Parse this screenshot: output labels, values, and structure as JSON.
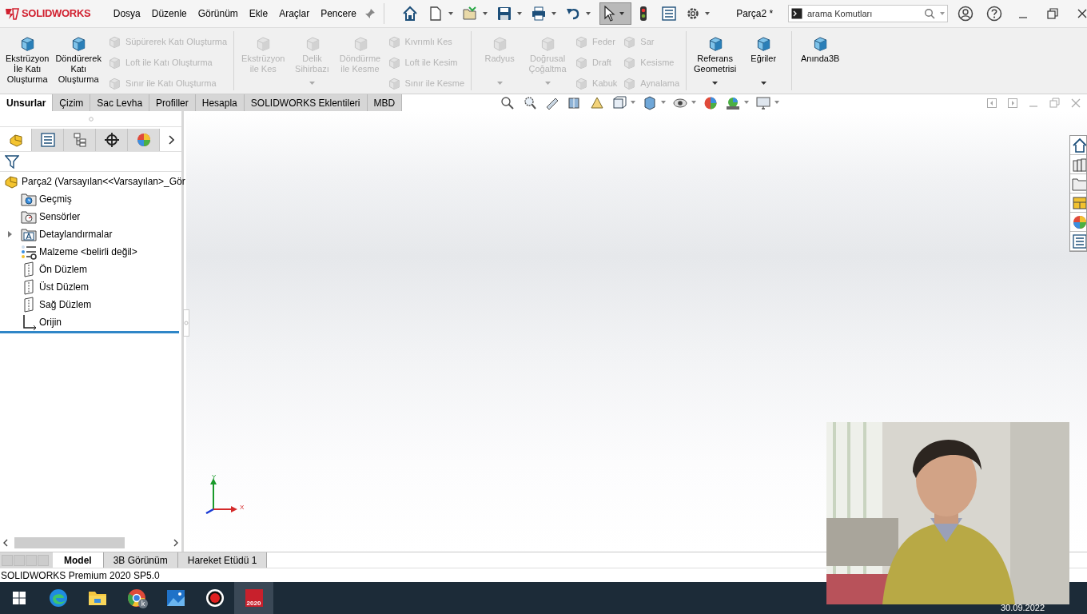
{
  "title_bar": {
    "app_name": "SOLIDWORKS",
    "menus": [
      "Dosya",
      "Düzenle",
      "Görünüm",
      "Ekle",
      "Araçlar",
      "Pencere"
    ],
    "document_title": "Parça2 *",
    "search": {
      "placeholder": "arama Komutları"
    }
  },
  "ribbon": {
    "groups": [
      {
        "columns": [
          {
            "kind": "large",
            "items": [
              {
                "label": "Ekstrüzyon\nİle Katı\nOluşturma",
                "disabled": false
              }
            ]
          },
          {
            "kind": "large",
            "items": [
              {
                "label": "Döndürerek\nKatı\nOluşturma",
                "disabled": false
              }
            ]
          },
          {
            "kind": "small",
            "items": [
              {
                "label": "Süpürerek Katı Oluşturma",
                "disabled": true
              },
              {
                "label": "Loft ile Katı Oluşturma",
                "disabled": true
              },
              {
                "label": "Sınır ile Katı Oluşturma",
                "disabled": true
              }
            ]
          }
        ]
      },
      {
        "columns": [
          {
            "kind": "large",
            "items": [
              {
                "label": "Ekstrüzyon\nile Kes",
                "disabled": true
              }
            ]
          },
          {
            "kind": "large",
            "items": [
              {
                "label": "Delik\nSihirbazı",
                "disabled": true,
                "has_menu": true
              }
            ]
          },
          {
            "kind": "large",
            "items": [
              {
                "label": "Döndürme\nile Kesme",
                "disabled": true
              }
            ]
          },
          {
            "kind": "small",
            "items": [
              {
                "label": "Kıvrımlı Kes",
                "disabled": true
              },
              {
                "label": "Loft ile Kesim",
                "disabled": true
              },
              {
                "label": "Sınır ile Kesme",
                "disabled": true
              }
            ]
          }
        ]
      },
      {
        "columns": [
          {
            "kind": "large",
            "items": [
              {
                "label": "Radyus",
                "disabled": true,
                "has_menu": true
              }
            ]
          },
          {
            "kind": "large",
            "items": [
              {
                "label": "Doğrusal\nÇoğaltma",
                "disabled": true,
                "has_menu": true
              }
            ]
          },
          {
            "kind": "small",
            "items": [
              {
                "label": "Feder",
                "disabled": true
              },
              {
                "label": "Draft",
                "disabled": true
              },
              {
                "label": "Kabuk",
                "disabled": true
              }
            ]
          },
          {
            "kind": "small",
            "items": [
              {
                "label": "Sar",
                "disabled": true
              },
              {
                "label": "Kesisme",
                "disabled": true
              },
              {
                "label": "Aynalama",
                "disabled": true
              }
            ]
          }
        ]
      },
      {
        "columns": [
          {
            "kind": "large",
            "items": [
              {
                "label": "Referans\nGeometrisi",
                "disabled": false,
                "has_menu": true
              }
            ]
          },
          {
            "kind": "large",
            "items": [
              {
                "label": "Eğriler",
                "disabled": false,
                "has_menu": true
              }
            ]
          }
        ]
      },
      {
        "columns": [
          {
            "kind": "large",
            "items": [
              {
                "label": "Anında3B",
                "disabled": false
              }
            ]
          }
        ]
      }
    ]
  },
  "command_tabs": [
    {
      "label": "Unsurlar",
      "selected": true
    },
    {
      "label": "Çizim",
      "selected": false
    },
    {
      "label": "Sac Levha",
      "selected": false
    },
    {
      "label": "Profiller",
      "selected": false
    },
    {
      "label": "Hesapla",
      "selected": false
    },
    {
      "label": "SOLIDWORKS Eklentileri",
      "selected": false
    },
    {
      "label": "MBD",
      "selected": false
    }
  ],
  "feature_manager": {
    "panel_tabs": [
      {
        "kind": "part",
        "selected": true
      },
      {
        "kind": "properties",
        "selected": false
      },
      {
        "kind": "config",
        "selected": false
      },
      {
        "kind": "target",
        "selected": false
      },
      {
        "kind": "appearance",
        "selected": false
      }
    ],
    "tree": [
      {
        "kind": "part",
        "label": "Parça2  (Varsayılan<<Varsayılan>_Gör"
      },
      {
        "kind": "history",
        "label": "Geçmiş"
      },
      {
        "kind": "sensor",
        "label": "Sensörler"
      },
      {
        "kind": "annotation",
        "label": "Detaylandırmalar",
        "expanded": false
      },
      {
        "kind": "material",
        "label": "Malzeme <belirli değil>"
      },
      {
        "kind": "plane",
        "label": "Ön Düzlem"
      },
      {
        "kind": "plane",
        "label": "Üst Düzlem"
      },
      {
        "kind": "plane",
        "label": "Sağ Düzlem"
      },
      {
        "kind": "origin",
        "label": "Orijin"
      }
    ]
  },
  "viewport": {
    "triad_labels": [
      "Y",
      "X"
    ]
  },
  "bottom_tabs": [
    {
      "label": "Model",
      "selected": true
    },
    {
      "label": "3B Görünüm",
      "selected": false
    },
    {
      "label": "Hareket Etüdü 1",
      "selected": false
    }
  ],
  "status_bar": "SOLIDWORKS Premium 2020 SP5.0",
  "taskbar": {
    "apps": [
      {
        "kind": "edge",
        "selected": false
      },
      {
        "kind": "explorer",
        "selected": false
      },
      {
        "kind": "chrome",
        "badge": "k",
        "selected": false
      },
      {
        "kind": "photos",
        "selected": false
      },
      {
        "kind": "recorder",
        "selected": false
      },
      {
        "kind": "solidworks",
        "label": "2020",
        "selected": true
      }
    ],
    "date": "30.09.2022"
  }
}
